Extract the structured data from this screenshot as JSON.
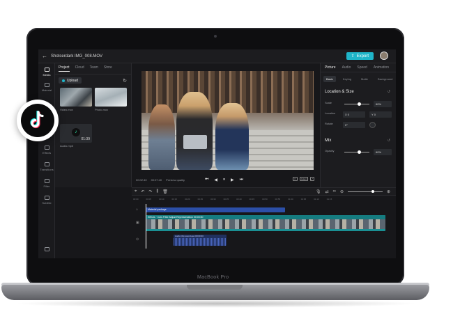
{
  "app": {
    "project_title": "Shotcerdark IMG_008.MOV",
    "export_label": "Export"
  },
  "rail": {
    "items": [
      {
        "label": "Media"
      },
      {
        "label": "Material"
      },
      {
        "label": "Effects"
      },
      {
        "label": "Transitions"
      },
      {
        "label": "Filter"
      },
      {
        "label": "Subtitle"
      }
    ]
  },
  "media": {
    "tabs": [
      "Project",
      "Cloud",
      "Team",
      "Store"
    ],
    "upload_label": "Upload",
    "items": [
      {
        "name": "Video.mov"
      },
      {
        "name": "Photo.mov"
      },
      {
        "name": "Audio.mp3",
        "duration": "01:39"
      }
    ]
  },
  "preview": {
    "current_time": "00:02:40",
    "total_time": "00:07:40",
    "quality_label": "Preview quality",
    "ratio_label": "Adapt"
  },
  "properties": {
    "tabs": [
      "Picture",
      "Audio",
      "Speed",
      "Animation"
    ],
    "subtabs": [
      "Basic",
      "Keying",
      "Matte",
      "Background"
    ],
    "location_section": "Location & Size",
    "scale_label": "Scale",
    "scale_value": "60%",
    "scale_level": 0.6,
    "location_label": "Location",
    "location_x": "X  0",
    "location_y": "Y  0",
    "rotate_label": "Rotate",
    "rotate_value": "0°",
    "mix_section": "Mix",
    "opacity_label": "Opacity",
    "opacity_value": "60%",
    "opacity_level": 0.6
  },
  "timeline": {
    "ruler": [
      "00:00",
      "00:05",
      "00:10",
      "00:15",
      "00:20",
      "00:25",
      "00:30",
      "00:35",
      "00:40",
      "00:45",
      "00:50",
      "00:55",
      "01:00",
      "01:05",
      "01:10",
      "01:15"
    ],
    "label_clip": "Material package",
    "main_clip_header": "Effects · Cuts   Filter   Adjust   Representation   00:00:00",
    "audio_clip_header": "Audio Clip   sound.aac   00:00:00"
  },
  "device": {
    "brand": "MacBook Pro"
  },
  "colors": {
    "accent": "#1fb5c9",
    "label_track": "#2c4fa8",
    "video_track": "#1a8f93",
    "audio_track": "#20305e"
  }
}
